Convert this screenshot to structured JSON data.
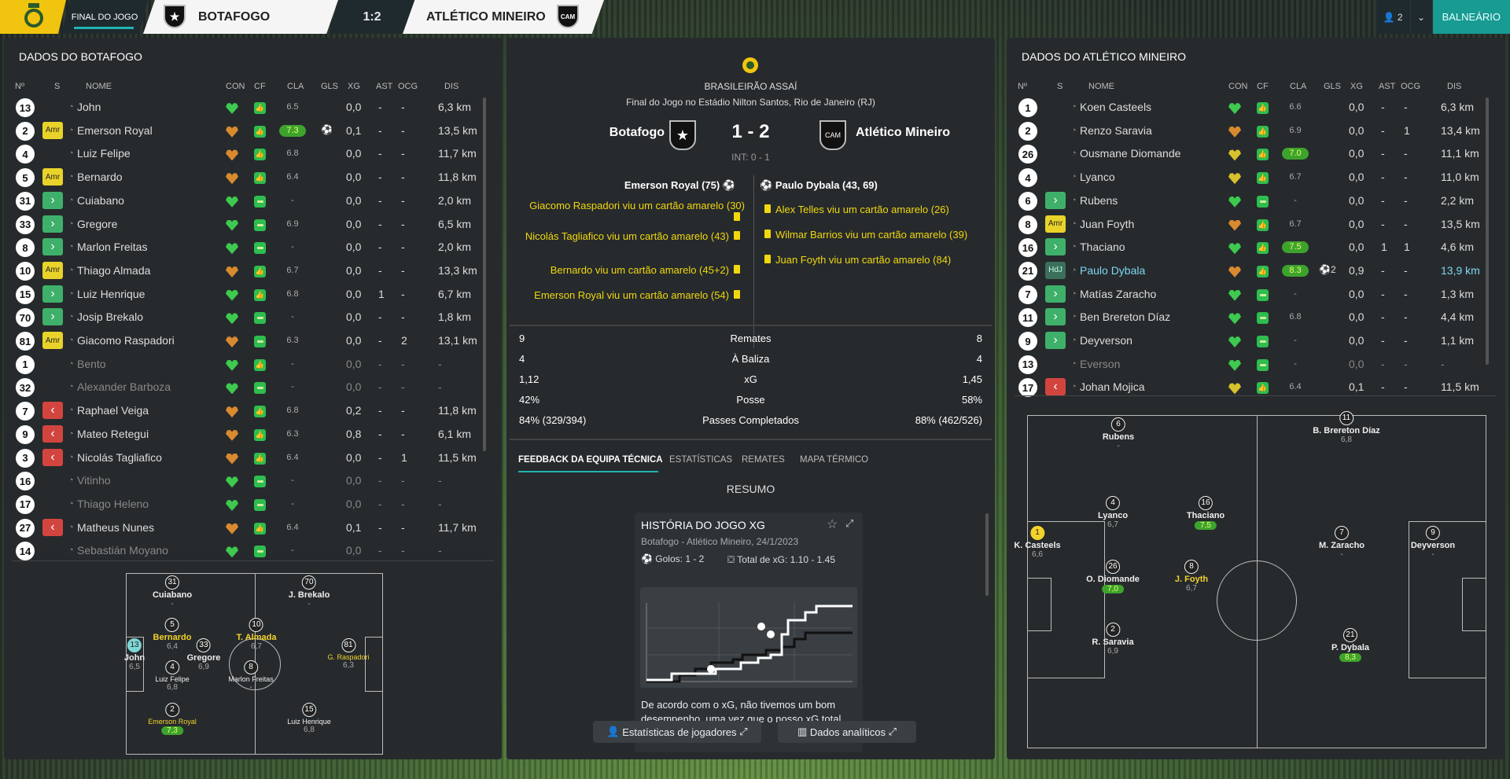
{
  "topbar": {
    "stage": "FINAL DO JOGO",
    "home": "BOTAFOGO",
    "score": "1:2",
    "away": "ATLÉTICO MINEIRO",
    "people": "2",
    "balneario": "BALNEÁRIO"
  },
  "left": {
    "title": "DADOS DO BOTAFOGO",
    "headers": [
      "Nº",
      "S",
      "NOME",
      "CON",
      "CF",
      "CLA",
      "GLS",
      "XG",
      "AST",
      "OCG",
      "DIS"
    ],
    "rows": [
      [
        "13",
        "",
        "John",
        "hg",
        "cf",
        "6.5",
        "",
        "0,0",
        "-",
        "-",
        "6,3 km"
      ],
      [
        "2",
        "Amr",
        "Emerson Royal",
        "ho",
        "cf",
        "7.3",
        "ball",
        "0,1",
        "-",
        "-",
        "13,5 km"
      ],
      [
        "4",
        "",
        "Luiz Felipe",
        "ho",
        "cf",
        "6.8",
        "",
        "0,0",
        "-",
        "-",
        "11,7 km"
      ],
      [
        "5",
        "Amr",
        "Bernardo",
        "ho",
        "cf",
        "6.4",
        "",
        "0,0",
        "-",
        "-",
        "11,8 km"
      ],
      [
        "31",
        "sub",
        "Cuiabano",
        "hg",
        "cy",
        "-",
        "",
        "0,0",
        "-",
        "-",
        "2,0 km"
      ],
      [
        "33",
        "sub",
        "Gregore",
        "hg",
        "cy",
        "6.9",
        "",
        "0,0",
        "-",
        "-",
        "6,5 km"
      ],
      [
        "8",
        "sub",
        "Marlon Freitas",
        "hg",
        "cy",
        "-",
        "",
        "0,0",
        "-",
        "-",
        "2,0 km"
      ],
      [
        "10",
        "Amr",
        "Thiago Almada",
        "ho",
        "cf",
        "6.7",
        "",
        "0,0",
        "-",
        "-",
        "13,3 km"
      ],
      [
        "15",
        "sub",
        "Luiz Henrique",
        "hg",
        "cf",
        "6.8",
        "",
        "0,0",
        "1",
        "-",
        "6,7 km"
      ],
      [
        "70",
        "sub",
        "Josip Brekalo",
        "hg",
        "cy",
        "-",
        "",
        "0,0",
        "-",
        "-",
        "1,8 km"
      ],
      [
        "81",
        "Amr",
        "Giacomo Raspadori",
        "ho",
        "cy",
        "6.3",
        "",
        "0,0",
        "-",
        "2",
        "13,1 km"
      ],
      [
        "1",
        "",
        "Bento",
        "hg",
        "cf",
        "-",
        "",
        "0,0",
        "-",
        "-",
        "-"
      ],
      [
        "32",
        "",
        "Alexander Barboza",
        "hg",
        "cy",
        "-",
        "",
        "0,0",
        "-",
        "-",
        "-"
      ],
      [
        "7",
        "off",
        "Raphael Veiga",
        "ho",
        "cf",
        "6.8",
        "",
        "0,2",
        "-",
        "-",
        "11,8 km"
      ],
      [
        "9",
        "off",
        "Mateo Retegui",
        "ho",
        "cf",
        "6.3",
        "",
        "0,8",
        "-",
        "-",
        "6,1 km"
      ],
      [
        "3",
        "off",
        "Nicolás Tagliafico",
        "ho",
        "cf",
        "6.4",
        "",
        "0,0",
        "-",
        "1",
        "11,5 km"
      ],
      [
        "16",
        "",
        "Vitinho",
        "hg",
        "cy",
        "-",
        "",
        "0,0",
        "-",
        "-",
        "-"
      ],
      [
        "17",
        "",
        "Thiago Heleno",
        "hg",
        "cy",
        "-",
        "",
        "0,0",
        "-",
        "-",
        "-"
      ],
      [
        "27",
        "off",
        "Matheus Nunes",
        "ho",
        "cf",
        "6.4",
        "",
        "0,1",
        "-",
        "-",
        "11,7 km"
      ],
      [
        "14",
        "",
        "Sebastián Moyano",
        "hg",
        "cy",
        "-",
        "",
        "0,0",
        "-",
        "-",
        "-"
      ]
    ]
  },
  "right": {
    "title": "DADOS DO ATLÉTICO MINEIRO",
    "headers": [
      "Nº",
      "S",
      "NOME",
      "CON",
      "CF",
      "CLA",
      "GLS",
      "XG",
      "AST",
      "OCG",
      "DIS"
    ],
    "rows": [
      [
        "1",
        "",
        "Koen Casteels",
        "hg",
        "cf",
        "6.6",
        "",
        "0,0",
        "-",
        "-",
        "6,3 km"
      ],
      [
        "2",
        "",
        "Renzo Saravia",
        "ho",
        "cf",
        "6.9",
        "",
        "0,0",
        "-",
        "1",
        "13,4 km"
      ],
      [
        "26",
        "",
        "Ousmane Diomande",
        "hy",
        "cf",
        "7.0",
        "",
        "0,0",
        "-",
        "-",
        "11,1 km"
      ],
      [
        "4",
        "",
        "Lyanco",
        "hy",
        "cf",
        "6.7",
        "",
        "0,0",
        "-",
        "-",
        "11,0 km"
      ],
      [
        "6",
        "sub",
        "Rubens",
        "hg",
        "cy",
        "-",
        "",
        "0,0",
        "-",
        "-",
        "2,2 km"
      ],
      [
        "8",
        "Amr",
        "Juan Foyth",
        "ho",
        "cf",
        "6.7",
        "",
        "0,0",
        "-",
        "-",
        "13,5 km"
      ],
      [
        "16",
        "sub",
        "Thaciano",
        "hg",
        "cf",
        "7.5",
        "",
        "0,0",
        "1",
        "1",
        "4,6 km"
      ],
      [
        "21",
        "HdJ",
        "Paulo Dybala",
        "ho",
        "cf",
        "8.3",
        "ball2",
        "0,9",
        "-",
        "-",
        "13,9 km"
      ],
      [
        "7",
        "sub",
        "Matías Zaracho",
        "hg",
        "cy",
        "-",
        "",
        "0,0",
        "-",
        "-",
        "1,3 km"
      ],
      [
        "11",
        "sub",
        "Ben Brereton Díaz",
        "hg",
        "cy",
        "6.8",
        "",
        "0,0",
        "-",
        "-",
        "4,4 km"
      ],
      [
        "9",
        "sub",
        "Deyverson",
        "hg",
        "cy",
        "-",
        "",
        "0,0",
        "-",
        "-",
        "1,1 km"
      ],
      [
        "13",
        "",
        "Everson",
        "hg",
        "cy",
        "-",
        "",
        "0,0",
        "-",
        "-",
        "-"
      ],
      [
        "17",
        "off",
        "Johan Mojica",
        "hy",
        "cf",
        "6.4",
        "",
        "0,1",
        "-",
        "-",
        "11,5 km"
      ]
    ]
  },
  "center": {
    "competition": "BRASILEIRÃO ASSAÍ",
    "venue": "Final do Jogo no Estádio Nilton Santos, Rio de Janeiro (RJ)",
    "home": "Botafogo",
    "away": "Atlético Mineiro",
    "score": "1 - 2",
    "ht": "INT: 0 - 1",
    "home_scorer": "Emerson Royal (75)",
    "away_scorer": "Paulo Dybala (43, 69)",
    "home_events": [
      "Giacomo Raspadori viu um cartão amarelo (30)",
      "Nicolás Tagliafico viu um cartão amarelo (43)",
      "Bernardo viu um cartão amarelo (45+2)",
      "Emerson Royal viu um cartão amarelo (54)"
    ],
    "away_events": [
      "Alex Telles viu um cartão amarelo (26)",
      "Wilmar Barrios viu um cartão amarelo (39)",
      "Juan Foyth viu um cartão amarelo (84)"
    ],
    "stats": [
      [
        "9",
        "Remates",
        "8"
      ],
      [
        "4",
        "À Baliza",
        "4"
      ],
      [
        "1,12",
        "xG",
        "1,45"
      ],
      [
        "42%",
        "Posse",
        "58%"
      ],
      [
        "84% (329/394)",
        "Passes Completados",
        "88% (462/526)"
      ]
    ],
    "tabs": [
      "FEEDBACK DA EQUIPA TÉCNICA",
      "ESTATÍSTICAS",
      "REMATES",
      "MAPA TÉRMICO"
    ],
    "summary": "RESUMO",
    "story_title": "HISTÓRIA DO JOGO XG",
    "story_sub": "Botafogo - Atlético Mineiro, 24/1/2023",
    "goals": "Golos: 1 - 2",
    "xg_total": "Total de xG: 1.10 - 1.45",
    "text": "De acordo com o xG, não tivemos um bom desempenho, uma vez que o nosso xG total",
    "btn_players": "Estatísticas de jogadores",
    "btn_analytics": "Dados analíticos"
  },
  "lineup_home": [
    {
      "n": "31",
      "name": "Cuiabano",
      "r": "-"
    },
    {
      "n": "70",
      "name": "J. Brekalo",
      "r": "-"
    },
    {
      "n": "5",
      "name": "Bernardo",
      "r": "6,4"
    },
    {
      "n": "33",
      "name": "Gregore",
      "r": "6,9"
    },
    {
      "n": "10",
      "name": "T. Almada",
      "r": "6,7"
    },
    {
      "n": "13",
      "name": "John",
      "r": "6,5"
    },
    {
      "n": "4",
      "name": "Luiz Felipe",
      "r": "6,8"
    },
    {
      "n": "8",
      "name": "Marlon Freitas",
      "r": "-"
    },
    {
      "n": "81",
      "name": "G. Raspadori",
      "r": "6,3"
    },
    {
      "n": "2",
      "name": "Emerson Royal",
      "r": "7,3"
    },
    {
      "n": "15",
      "name": "Luiz Henrique",
      "r": "6,8"
    }
  ],
  "lineup_away": [
    {
      "n": "6",
      "name": "Rubens",
      "r": "-"
    },
    {
      "n": "11",
      "name": "B. Brereton Díaz",
      "r": "6,8"
    },
    {
      "n": "4",
      "name": "Lyanco",
      "r": "6,7"
    },
    {
      "n": "16",
      "name": "Thaciano",
      "r": "7,5"
    },
    {
      "n": "1",
      "name": "K. Casteels",
      "r": "6,6"
    },
    {
      "n": "7",
      "name": "M. Zaracho",
      "r": "-"
    },
    {
      "n": "9",
      "name": "Deyverson",
      "r": "-"
    },
    {
      "n": "26",
      "name": "O. Diomande",
      "r": "7,0"
    },
    {
      "n": "8",
      "name": "J. Foyth",
      "r": "6,7"
    },
    {
      "n": "2",
      "name": "R. Saravia",
      "r": "6,9"
    },
    {
      "n": "21",
      "name": "P. Dybala",
      "r": "8,3"
    }
  ],
  "colors": {
    "teal": "#179b93",
    "yellow": "#f1d70e",
    "rating_green": "#3ea32d"
  }
}
